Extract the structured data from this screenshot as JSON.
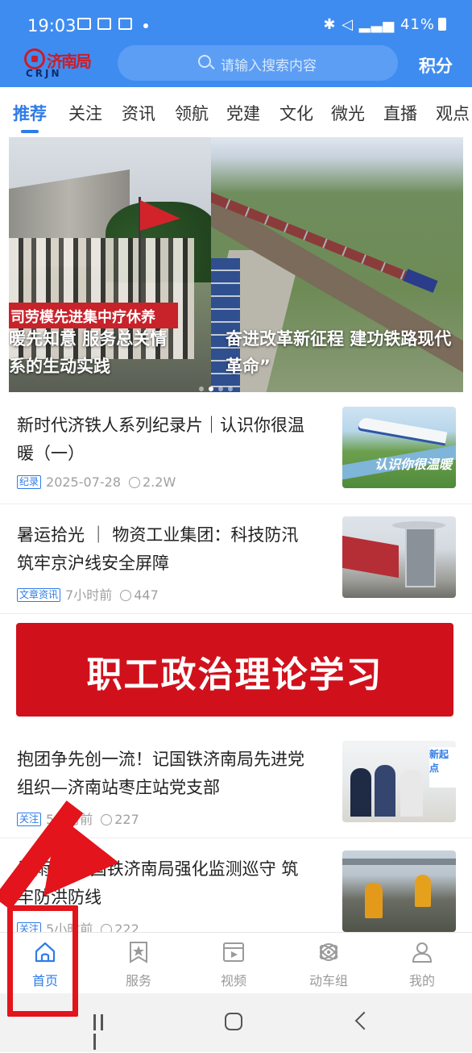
{
  "status_bar": {
    "time": "19:03",
    "right": "41%"
  },
  "header": {
    "logo_cn": "济南局",
    "logo_en": "CRJN",
    "search_placeholder": "请输入搜索内容",
    "points_label": "积分"
  },
  "tabs": [
    {
      "label": "推荐",
      "active": true
    },
    {
      "label": "关注"
    },
    {
      "label": "资讯"
    },
    {
      "label": "领航"
    },
    {
      "label": "党建"
    },
    {
      "label": "文化"
    },
    {
      "label": "微光"
    },
    {
      "label": "直播"
    },
    {
      "label": "观点"
    }
  ],
  "banner": {
    "slide_a_sign": "司劳模先进集中疗休养",
    "caption_a_line1": "暖先知意 服务总关情",
    "caption_a_line2": "系的生动实践",
    "caption_b_line1": "奋进改革新征程 建功铁路现代",
    "caption_b_line2": "革命”"
  },
  "news": [
    {
      "title": "新时代济铁人系列纪录片｜认识你很温暖（一）",
      "tag": "纪录",
      "time": "2025-07-28",
      "views": "2.2W",
      "thumb_text": "认识你很温暖"
    },
    {
      "title": "暑运拾光 ｜ 物资工业集团：科技防汛筑牢京沪线安全屏障",
      "tag": "文章资讯",
      "time": "7小时前",
      "views": "447"
    },
    {
      "title": "抱团争先创一流！记国铁济南局先进党组织—济南站枣庄站党支部",
      "tag": "关注",
      "time": "5小时前",
      "views": "227",
      "thumb_text": "新起点"
    },
    {
      "title": "暴雨来袭 国铁济南局强化监测巡守 筑牢防洪防线",
      "tag": "关注",
      "time": "5小时前",
      "views": "222"
    }
  ],
  "promo": {
    "text": "职工政治理论学习"
  },
  "bottom_nav": [
    {
      "label": "首页",
      "icon": "home-icon",
      "active": true
    },
    {
      "label": "服务",
      "icon": "bookmark-star-icon"
    },
    {
      "label": "视频",
      "icon": "video-icon"
    },
    {
      "label": "动车组",
      "icon": "atom-icon"
    },
    {
      "label": "我的",
      "icon": "user-icon"
    }
  ],
  "colors": {
    "accent": "#2f7ce8",
    "header_bg": "#3f8cf0",
    "promo_bg": "#d0111c",
    "annotation_red": "#e3141b"
  }
}
